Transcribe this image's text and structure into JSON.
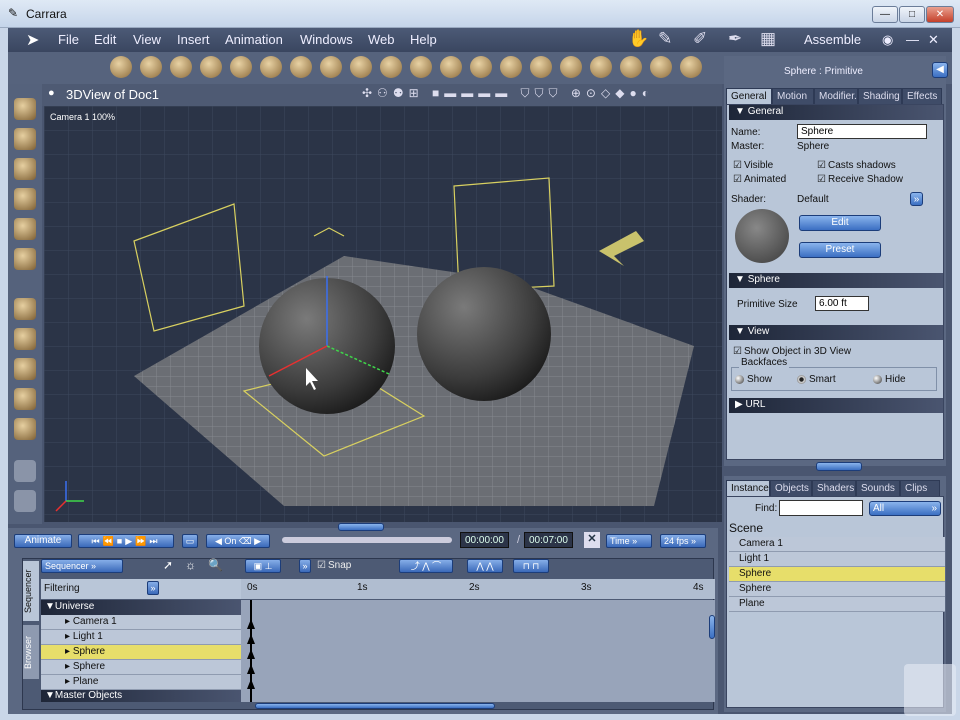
{
  "window": {
    "title": "Carrara",
    "minimize": "—",
    "maximize": "□",
    "close": "✕"
  },
  "menu": [
    "File",
    "Edit",
    "View",
    "Insert",
    "Animation",
    "Windows",
    "Web",
    "Help"
  ],
  "room": {
    "label": "Assemble",
    "min": "—",
    "max": "□",
    "close": "✕"
  },
  "view": {
    "title": "3DView of Doc1",
    "camera_label": "Camera 1 100%"
  },
  "properties": {
    "header": "Sphere : Primitive",
    "tabs": [
      "General",
      "Motion",
      "Modifier.",
      "Shading",
      "Effects"
    ],
    "general_section": "General",
    "name_label": "Name:",
    "name_value": "Sphere",
    "master_label": "Master:",
    "master_value": "Sphere",
    "visible": "Visible",
    "casts_shadows": "Casts shadows",
    "animated": "Animated",
    "receive_shadow": "Receive Shadow",
    "shader_label": "Shader:",
    "shader_value": "Default",
    "edit": "Edit",
    "preset": "Preset",
    "sphere_section": "Sphere",
    "primitive_size_label": "Primitive Size",
    "primitive_size_value": "6.00 ft",
    "view_section": "View",
    "show_object": "Show Object in 3D View",
    "backfaces": "Backfaces",
    "bf_show": "Show",
    "bf_smart": "Smart",
    "bf_hide": "Hide",
    "url_section": "URL"
  },
  "browser": {
    "tabs": [
      "Instance",
      "Objects",
      "Shaders",
      "Sounds",
      "Clips"
    ],
    "find_label": "Find:",
    "find_value": "",
    "filter": "All",
    "scene_label": "Scene",
    "items": [
      "Camera 1",
      "Light 1",
      "Sphere",
      "Sphere",
      "Plane"
    ]
  },
  "timeline": {
    "animate": "Animate",
    "current_time": "00:00:00",
    "separator": "/",
    "end_time": "00:07:00",
    "time_mode": "Time",
    "fps": "24 fps",
    "side_tabs": [
      "Sequencer",
      "Browser"
    ],
    "mode": "Sequencer",
    "filtering": "Filtering",
    "snap": "Snap",
    "ruler": [
      "0s",
      "1s",
      "2s",
      "3s",
      "4s"
    ],
    "universe": "Universe",
    "rows": [
      "Camera 1",
      "Light 1",
      "Sphere",
      "Sphere",
      "Plane"
    ],
    "master_objects": "Master Objects"
  }
}
